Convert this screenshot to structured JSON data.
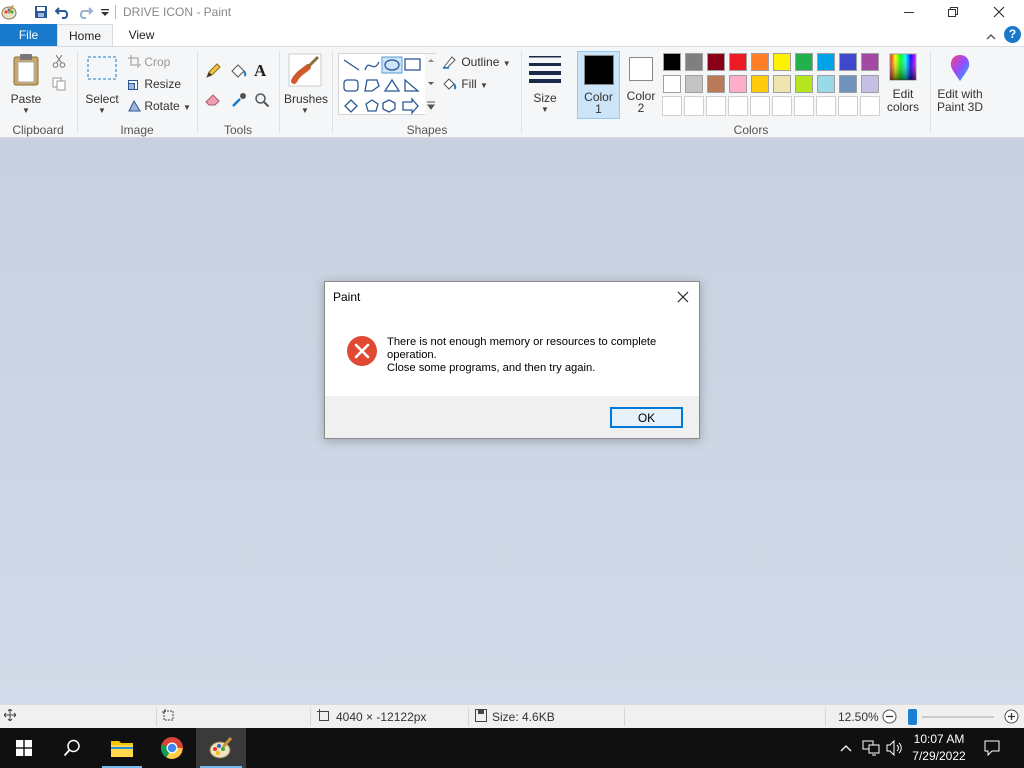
{
  "window": {
    "title": "DRIVE ICON - Paint"
  },
  "tabs": [
    {
      "label": "File"
    },
    {
      "label": "Home"
    },
    {
      "label": "View"
    }
  ],
  "ribbon": {
    "clipboard": {
      "paste": "Paste",
      "group": "Clipboard"
    },
    "image": {
      "select": "Select",
      "crop": "Crop",
      "resize": "Resize",
      "rotate": "Rotate",
      "group": "Image"
    },
    "tools": {
      "group": "Tools",
      "text_tool": "A"
    },
    "brushes": {
      "label": "Brushes"
    },
    "shapes": {
      "outline": "Outline",
      "fill": "Fill",
      "group": "Shapes"
    },
    "size": {
      "label": "Size"
    },
    "colors": {
      "color1": "Color",
      "color1_num": "1",
      "color2": "Color",
      "color2_num": "2",
      "edit_colors": "Edit colors",
      "group": "Colors",
      "color1_value": "#000000",
      "color2_value": "#ffffff",
      "palette_row1": [
        "#000000",
        "#7f7f7f",
        "#880015",
        "#ed1c24",
        "#ff7f27",
        "#fff200",
        "#22b14c",
        "#00a2e8",
        "#3f48cc",
        "#a349a4"
      ],
      "palette_row2": [
        "#ffffff",
        "#c3c3c3",
        "#b97a57",
        "#ffaec9",
        "#ffc90e",
        "#efe4b0",
        "#b5e61d",
        "#99d9ea",
        "#7092be",
        "#c8bfe7"
      ]
    },
    "paint3d": {
      "label": "Edit with Paint 3D"
    }
  },
  "dialog": {
    "title": "Paint",
    "message_line1": "There is not enough memory or resources to complete",
    "message_line2": "operation.",
    "message_line3": "Close some programs, and then try again.",
    "ok": "OK"
  },
  "status": {
    "dimensions": "4040 × -12122px",
    "size": "Size: 4.6KB",
    "zoom": "12.50%"
  },
  "taskbar": {
    "time": "10:07 AM",
    "date": "7/29/2022"
  },
  "colors": {
    "accent": "#1979ca",
    "error_red": "#e04a35",
    "workspace": "#c8d0e0"
  }
}
